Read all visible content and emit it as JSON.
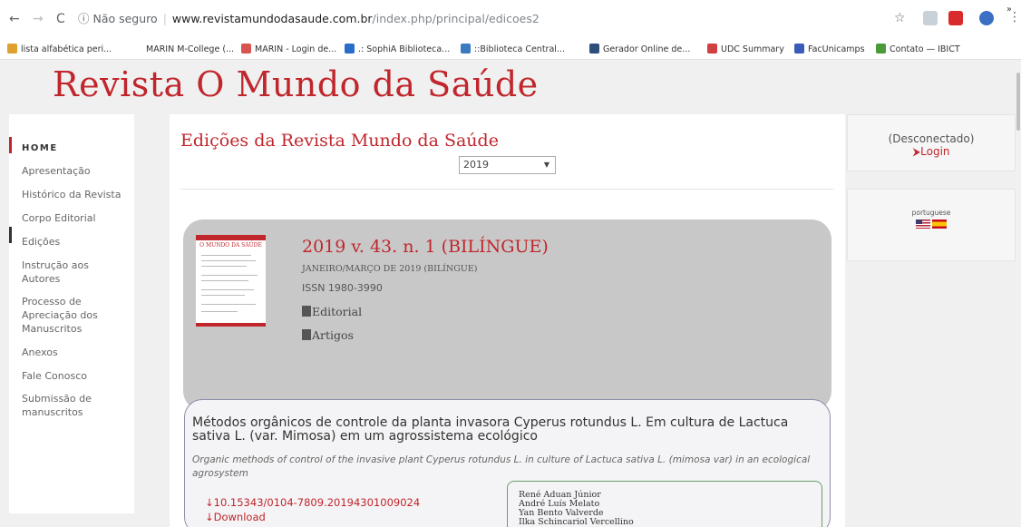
{
  "browser": {
    "nav": {
      "back": "←",
      "forward": "→",
      "reload": "C"
    },
    "url": {
      "security": "ⓘ Não seguro",
      "host": "www.revistamundodasaude.com.br",
      "path": "/index.php/principal/edicoes2"
    },
    "star": "☆",
    "menu": "⋮",
    "bookmarks": [
      {
        "label": "lista alfabética peri...",
        "icon_color": "#e0a030"
      },
      {
        "label": "MARIN M-College (...",
        "icon_color": "#ffffff"
      },
      {
        "label": "MARIN - Login de...",
        "icon_color": "#d9534f"
      },
      {
        "label": ".: SophiA Biblioteca...",
        "icon_color": "#2a6cc9"
      },
      {
        "label": "::Biblioteca Central...",
        "icon_color": "#3a7ac0"
      },
      {
        "label": "Gerador Online de...",
        "icon_color": "#2c4f7c"
      },
      {
        "label": "UDC Summary",
        "icon_color": "#d04040"
      },
      {
        "label": "FacUnicamps",
        "icon_color": "#3a5cb8"
      },
      {
        "label": "Contato — IBICT",
        "icon_color": "#4a9a3a"
      }
    ],
    "bookmarks_more": "»"
  },
  "site": {
    "title": "Revista O Mundo da Saúde",
    "accent": "#c0262c"
  },
  "sidebar": {
    "home": "HOME",
    "items": [
      "Apresentação",
      "Histórico da Revista",
      "Corpo Editorial",
      "Edições",
      "Instrução aos Autores",
      "Processo de Apreciação dos Manuscritos",
      "Anexos",
      "Fale Conosco",
      "Submissão de manuscritos"
    ]
  },
  "main": {
    "title": "Edições da Revista Mundo da Saúde",
    "year_selected": "2019",
    "issue": {
      "cover_title": "O MUNDO DA SAÚDE",
      "title": "2019 v. 43. n. 1 (BILÍNGUE)",
      "date": "JANEIRO/MARÇO DE 2019 (BILÍNGUE)",
      "issn": "ISSN 1980-3990",
      "editorial": "Editorial",
      "artigos": "Artigos"
    },
    "article": {
      "title": "Métodos orgânicos de controle da planta invasora Cyperus rotundus L. Em cultura de Lactuca sativa L. (var. Mimosa) em um agrossistema ecológico",
      "subtitle": "Organic methods of control of the invasive plant Cyperus rotundus L. in culture of Lactuca sativa L. (mimosa var) in an ecological agrosystem",
      "doi": "↓10.15343/0104-7809.20194301009024",
      "download": "↓Download",
      "authors": [
        "René Aduan Júnior",
        "André Luís Melato",
        "Yan Bento Valverde",
        "Ilka Schincariol Vercellino"
      ]
    }
  },
  "right": {
    "status": "(Desconectado)",
    "login": "⮞Login",
    "language_label": "portuguese"
  }
}
